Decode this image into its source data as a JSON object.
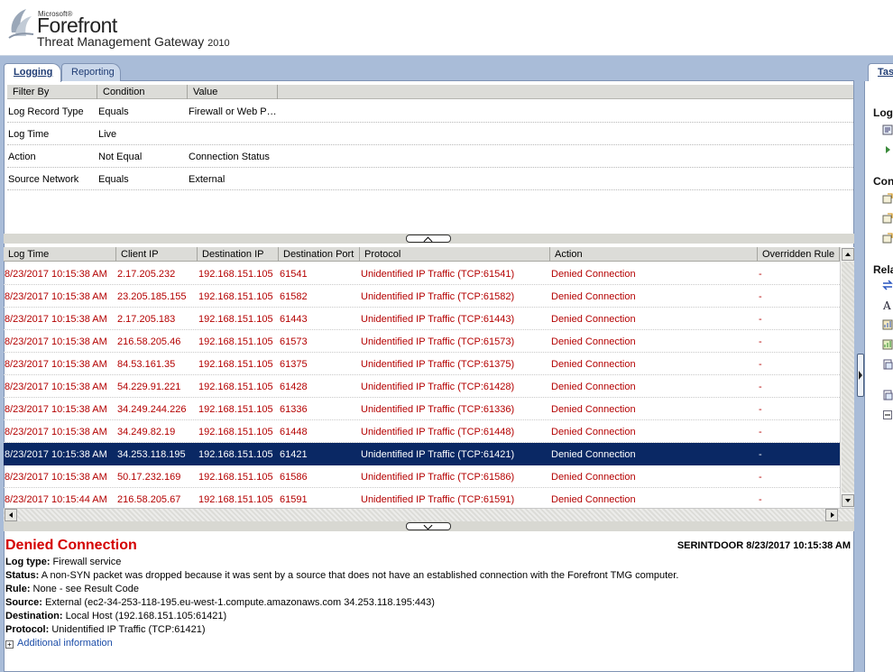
{
  "header": {
    "vendor": "Microsoft®",
    "product": "Forefront",
    "subtitle": "Threat Management Gateway",
    "year": "2010"
  },
  "tabs": [
    {
      "label": "Logging",
      "active": true
    },
    {
      "label": "Reporting",
      "active": false
    }
  ],
  "right_panel": {
    "tab_label": "Tas",
    "headings": [
      "Log",
      "Con",
      "Rela"
    ]
  },
  "filter": {
    "columns": [
      "Filter By",
      "Condition",
      "Value"
    ],
    "rows": [
      [
        "Log Record Type",
        "Equals",
        "Firewall or Web P…"
      ],
      [
        "Log Time",
        "Live",
        ""
      ],
      [
        "Action",
        "Not Equal",
        "Connection Status"
      ],
      [
        "Source Network",
        "Equals",
        "External"
      ]
    ]
  },
  "grid": {
    "columns": [
      "Log Time",
      "Client IP",
      "Destination IP",
      "Destination Port",
      "Protocol",
      "Action",
      "Overridden Rule"
    ],
    "selected_index": 8,
    "row_color": "#b40000",
    "selected_bg": "#0a2864",
    "rows": [
      [
        "8/23/2017 10:15:38 AM",
        "2.17.205.232",
        "192.168.151.105",
        "61541",
        "Unidentified IP Traffic (TCP:61541)",
        "Denied Connection",
        "-"
      ],
      [
        "8/23/2017 10:15:38 AM",
        "23.205.185.155",
        "192.168.151.105",
        "61582",
        "Unidentified IP Traffic (TCP:61582)",
        "Denied Connection",
        "-"
      ],
      [
        "8/23/2017 10:15:38 AM",
        "2.17.205.183",
        "192.168.151.105",
        "61443",
        "Unidentified IP Traffic (TCP:61443)",
        "Denied Connection",
        "-"
      ],
      [
        "8/23/2017 10:15:38 AM",
        "216.58.205.46",
        "192.168.151.105",
        "61573",
        "Unidentified IP Traffic (TCP:61573)",
        "Denied Connection",
        "-"
      ],
      [
        "8/23/2017 10:15:38 AM",
        "84.53.161.35",
        "192.168.151.105",
        "61375",
        "Unidentified IP Traffic (TCP:61375)",
        "Denied Connection",
        "-"
      ],
      [
        "8/23/2017 10:15:38 AM",
        "54.229.91.221",
        "192.168.151.105",
        "61428",
        "Unidentified IP Traffic (TCP:61428)",
        "Denied Connection",
        "-"
      ],
      [
        "8/23/2017 10:15:38 AM",
        "34.249.244.226",
        "192.168.151.105",
        "61336",
        "Unidentified IP Traffic (TCP:61336)",
        "Denied Connection",
        "-"
      ],
      [
        "8/23/2017 10:15:38 AM",
        "34.249.82.19",
        "192.168.151.105",
        "61448",
        "Unidentified IP Traffic (TCP:61448)",
        "Denied Connection",
        "-"
      ],
      [
        "8/23/2017 10:15:38 AM",
        "34.253.118.195",
        "192.168.151.105",
        "61421",
        "Unidentified IP Traffic (TCP:61421)",
        "Denied Connection",
        "-"
      ],
      [
        "8/23/2017 10:15:38 AM",
        "50.17.232.169",
        "192.168.151.105",
        "61586",
        "Unidentified IP Traffic (TCP:61586)",
        "Denied Connection",
        "-"
      ],
      [
        "8/23/2017 10:15:44 AM",
        "216.58.205.67",
        "192.168.151.105",
        "61591",
        "Unidentified IP Traffic (TCP:61591)",
        "Denied Connection",
        "-"
      ]
    ]
  },
  "details": {
    "title": "Denied Connection",
    "stamp": "SERINTDOOR 8/23/2017 10:15:38 AM",
    "lines": [
      {
        "label": "Log type:",
        "value": " Firewall service"
      },
      {
        "label": "Status:",
        "value": " A non-SYN packet was dropped because it was sent by a source that does not have an established connection with the Forefront TMG computer."
      },
      {
        "label": "Rule:",
        "value": " None - see Result Code"
      },
      {
        "label": "Source:",
        "value": " External (ec2-34-253-118-195.eu-west-1.compute.amazonaws.com 34.253.118.195:443)"
      },
      {
        "label": "Destination:",
        "value": " Local Host (192.168.151.105:61421)"
      },
      {
        "label": "Protocol:",
        "value": " Unidentified IP Traffic (TCP:61421)"
      }
    ],
    "more_label": "Additional information"
  }
}
